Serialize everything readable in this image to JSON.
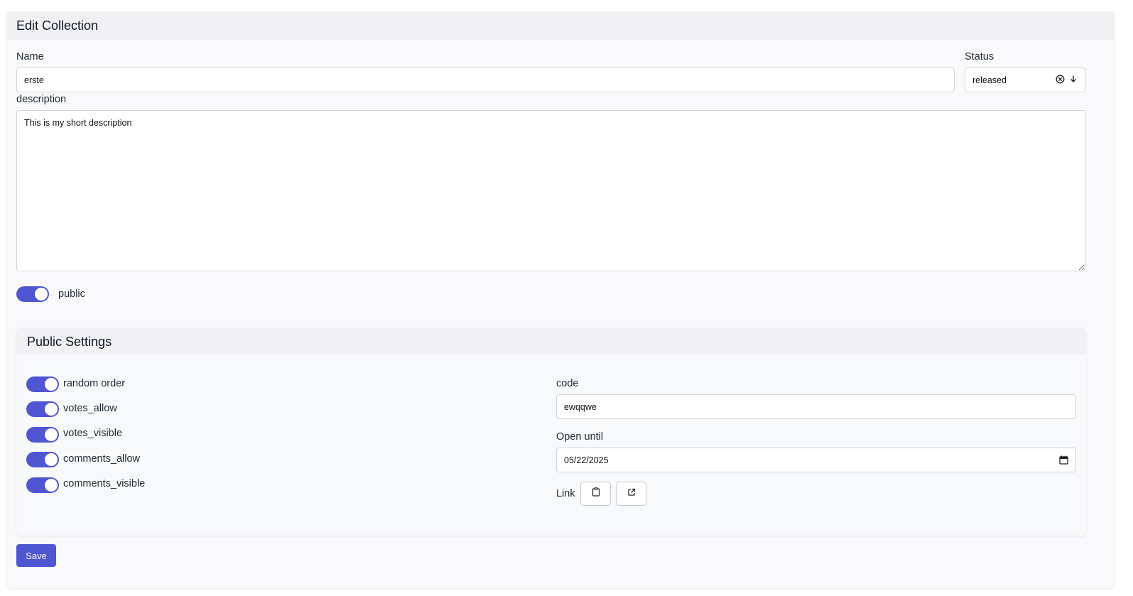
{
  "page": {
    "title": "Edit Collection"
  },
  "form": {
    "name_label": "Name",
    "name_value": "erste",
    "status_label": "Status",
    "status_value": "released",
    "description_label": "description",
    "description_value": "This is my short description",
    "public_label": "public",
    "public_on": true
  },
  "public_settings": {
    "title": "Public Settings",
    "toggles": [
      {
        "label": "random order",
        "on": true
      },
      {
        "label": "votes_allow",
        "on": true
      },
      {
        "label": "votes_visible",
        "on": true
      },
      {
        "label": "comments_allow",
        "on": true
      },
      {
        "label": "comments_visible",
        "on": true
      }
    ],
    "code_label": "code",
    "code_value": "ewqqwe",
    "open_until_label": "Open until",
    "open_until_value": "05/22/2025",
    "link_label": "Link",
    "copy_icon": "clipboard-icon",
    "open_icon": "external-link-icon"
  },
  "actions": {
    "save_label": "Save"
  },
  "colors": {
    "accent": "#4f56d2"
  }
}
